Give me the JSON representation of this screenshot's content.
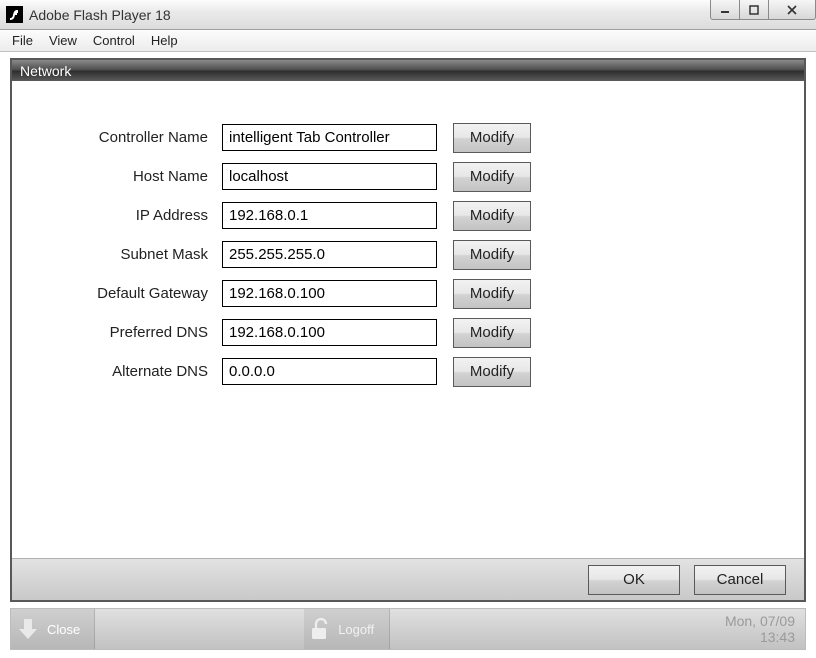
{
  "window": {
    "title": "Adobe Flash Player 18"
  },
  "menu": {
    "file": "File",
    "view": "View",
    "control": "Control",
    "help": "Help"
  },
  "panel": {
    "title": "Network",
    "modify_label": "Modify",
    "ok_label": "OK",
    "cancel_label": "Cancel",
    "fields": {
      "controller_name": {
        "label": "Controller Name",
        "value": "intelligent Tab Controller"
      },
      "host_name": {
        "label": "Host Name",
        "value": "localhost"
      },
      "ip_address": {
        "label": "IP Address",
        "value": "192.168.0.1"
      },
      "subnet_mask": {
        "label": "Subnet Mask",
        "value": "255.255.255.0"
      },
      "default_gateway": {
        "label": "Default Gateway",
        "value": "192.168.0.100"
      },
      "preferred_dns": {
        "label": "Preferred DNS",
        "value": "192.168.0.100"
      },
      "alternate_dns": {
        "label": "Alternate DNS",
        "value": "0.0.0.0"
      }
    }
  },
  "status": {
    "close_label": "Close",
    "logoff_label": "Logoff",
    "date": "Mon, 07/09",
    "time": "13:43"
  }
}
